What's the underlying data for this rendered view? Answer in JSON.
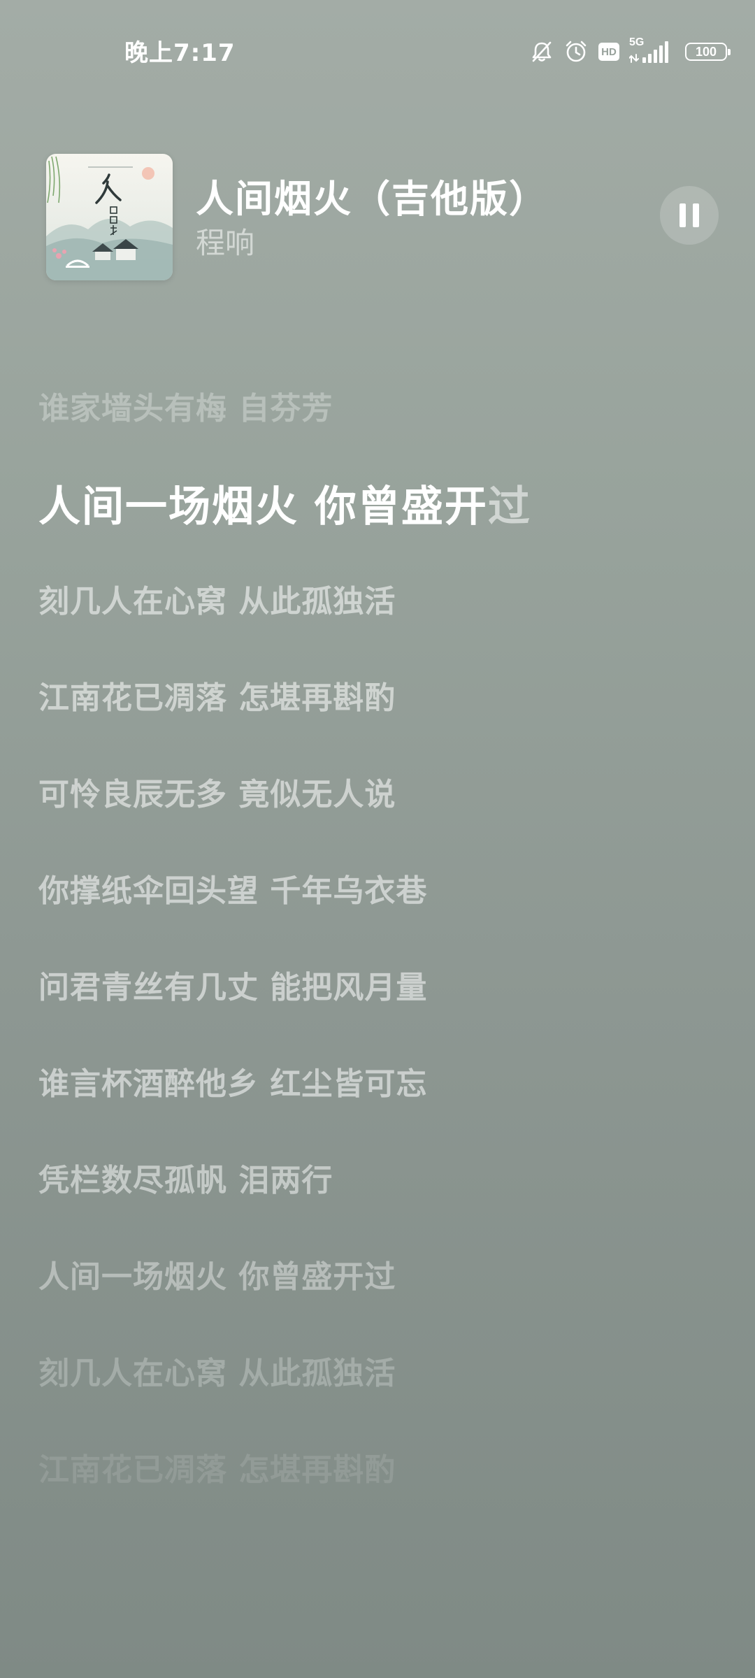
{
  "status_bar": {
    "time": "晚上7:17",
    "network": "5G",
    "battery": "100",
    "hd_label": "HD",
    "icons": [
      "bell-muted-icon",
      "alarm-icon",
      "hd-icon",
      "signal-icon",
      "battery-icon"
    ]
  },
  "now_playing": {
    "title": "人间烟火（吉他版）",
    "artist": "程响",
    "album_art_text": "人间烟火",
    "pause_icon": "pause-icon",
    "state": "playing"
  },
  "lyrics": {
    "previous": "谁家墙头有梅 自芬芳",
    "current_sung": "人间一场烟火 你曾盛开",
    "current_rest": "过",
    "upcoming": [
      "刻几人在心窝 从此孤独活",
      "江南花已凋落 怎堪再斟酌",
      "可怜良辰无多 竟似无人说",
      "你撑纸伞回头望 千年乌衣巷",
      "问君青丝有几丈 能把风月量",
      "谁言杯酒醉他乡 红尘皆可忘",
      "凭栏数尽孤帆 泪两行",
      "人间一场烟火 你曾盛开过",
      "刻几人在心窝 从此孤独活",
      "江南花已凋落 怎堪再斟酌"
    ]
  },
  "colors": {
    "background_top": "#a3aca6",
    "background_bottom": "#7f8a85",
    "text_primary": "#ffffff"
  }
}
